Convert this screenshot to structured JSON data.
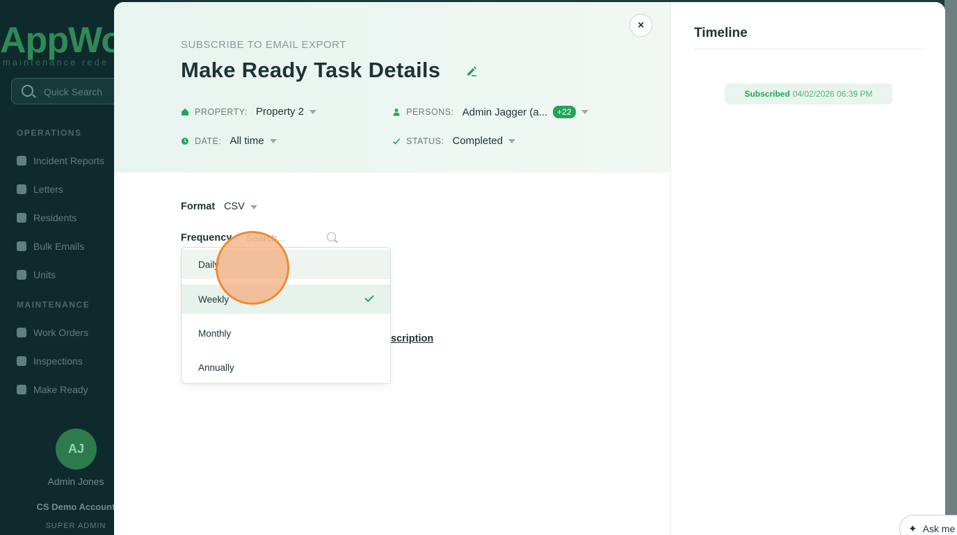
{
  "sidebar": {
    "logo_text": "AppWo",
    "logo_sub": "maintenance rede",
    "search_placeholder": "Quick Search",
    "operations_heading": "OPERATIONS",
    "operations": [
      "Incident Reports",
      "Letters",
      "Residents",
      "Bulk Emails",
      "Units"
    ],
    "maintenance_heading": "MAINTENANCE",
    "maintenance": [
      "Work Orders",
      "Inspections",
      "Make Ready"
    ],
    "user_initials": "AJ",
    "user_name": "Admin Jones",
    "account": "CS Demo Account",
    "role": "SUPER ADMIN"
  },
  "modal": {
    "eyebrow": "SUBSCRIBE TO EMAIL EXPORT",
    "title": "Make Ready Task Details",
    "close_label": "×",
    "filters": {
      "property_label": "PROPERTY:",
      "property_value": "Property 2",
      "persons_label": "PERSONS:",
      "persons_value": "Admin Jagger (a...",
      "persons_extra": "+22",
      "date_label": "DATE:",
      "date_value": "All time",
      "status_label": "STATUS:",
      "status_value": "Completed"
    },
    "format_label": "Format",
    "format_value": "CSV",
    "frequency_label": "Frequency",
    "frequency_search_placeholder": "Search...",
    "frequency_options": [
      "Daily",
      "Weekly",
      "Monthly",
      "Annually"
    ],
    "frequency_selected": "Weekly",
    "partial_link_text": "scription"
  },
  "timeline": {
    "title": "Timeline",
    "event_label": "Subscribed",
    "event_date": "04/02/2026 06:39 PM"
  },
  "assistant": {
    "label": "Ask me"
  },
  "colors": {
    "accent": "#22a45a",
    "header_bg": "#e8f4ef",
    "text_dark": "#1d3336",
    "cursor_ring": "#f08a30"
  }
}
